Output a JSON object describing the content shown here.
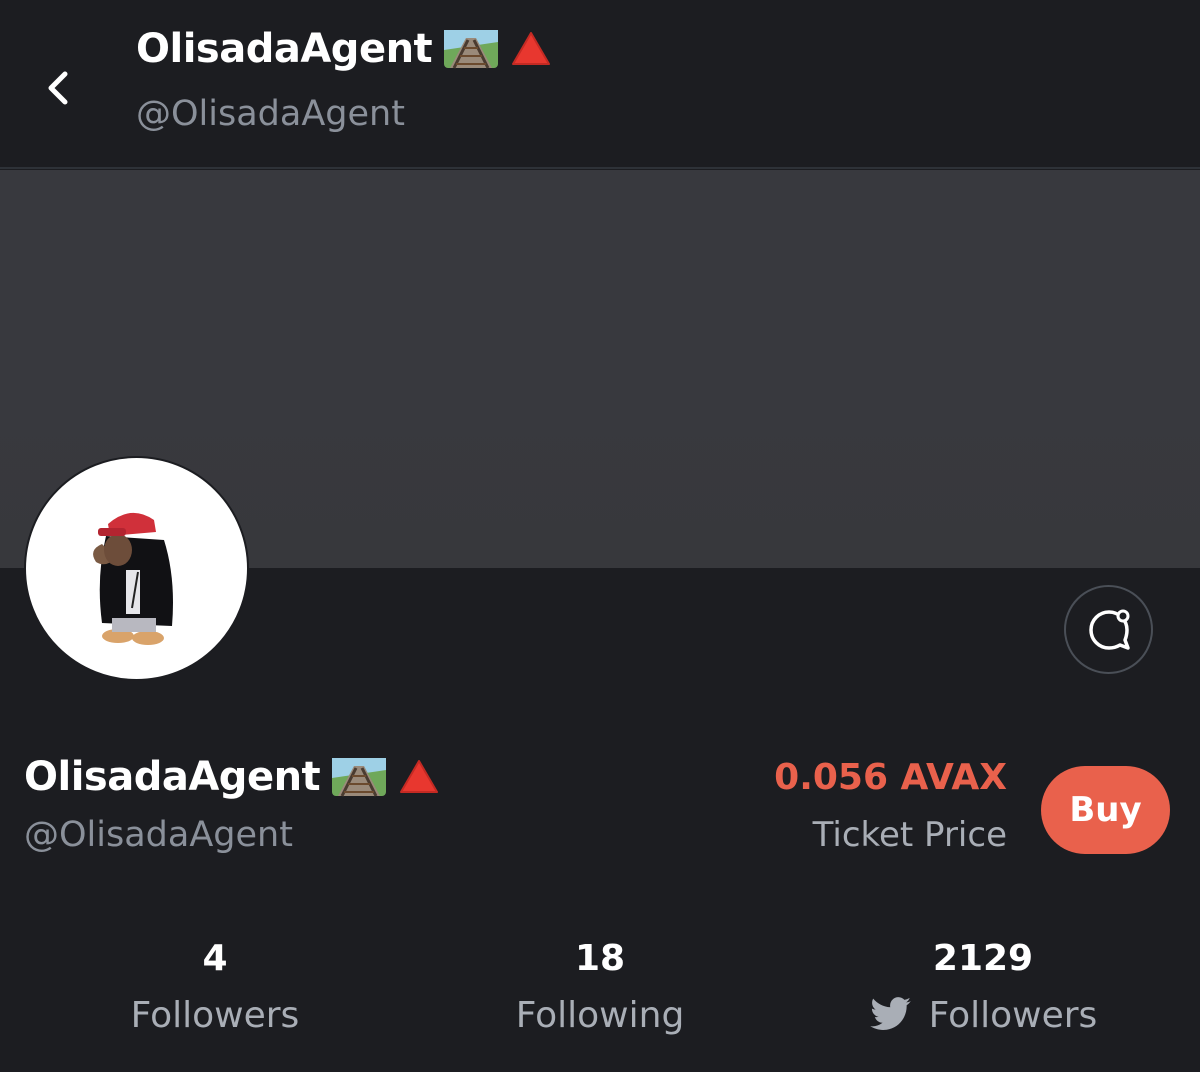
{
  "header": {
    "name": "OlisadaAgent",
    "handle": "@OlisadaAgent",
    "emoji_icons": [
      "railway-track-icon",
      "red-triangle-icon"
    ]
  },
  "profile": {
    "name": "OlisadaAgent",
    "handle": "@OlisadaAgent",
    "emoji_icons": [
      "railway-track-icon",
      "red-triangle-icon"
    ],
    "avatar_icon": "penguin-avatar"
  },
  "ticket": {
    "price": "0.056 AVAX",
    "label": "Ticket Price",
    "buy_label": "Buy"
  },
  "stats": [
    {
      "value": "4",
      "label": "Followers"
    },
    {
      "value": "18",
      "label": "Following"
    },
    {
      "value": "2129",
      "label": "Followers",
      "icon": "twitter-bird-icon"
    }
  ],
  "colors": {
    "background": "#1c1d21",
    "banner": "#38393e",
    "accent": "#e9614c",
    "muted_text": "#8a909a"
  }
}
